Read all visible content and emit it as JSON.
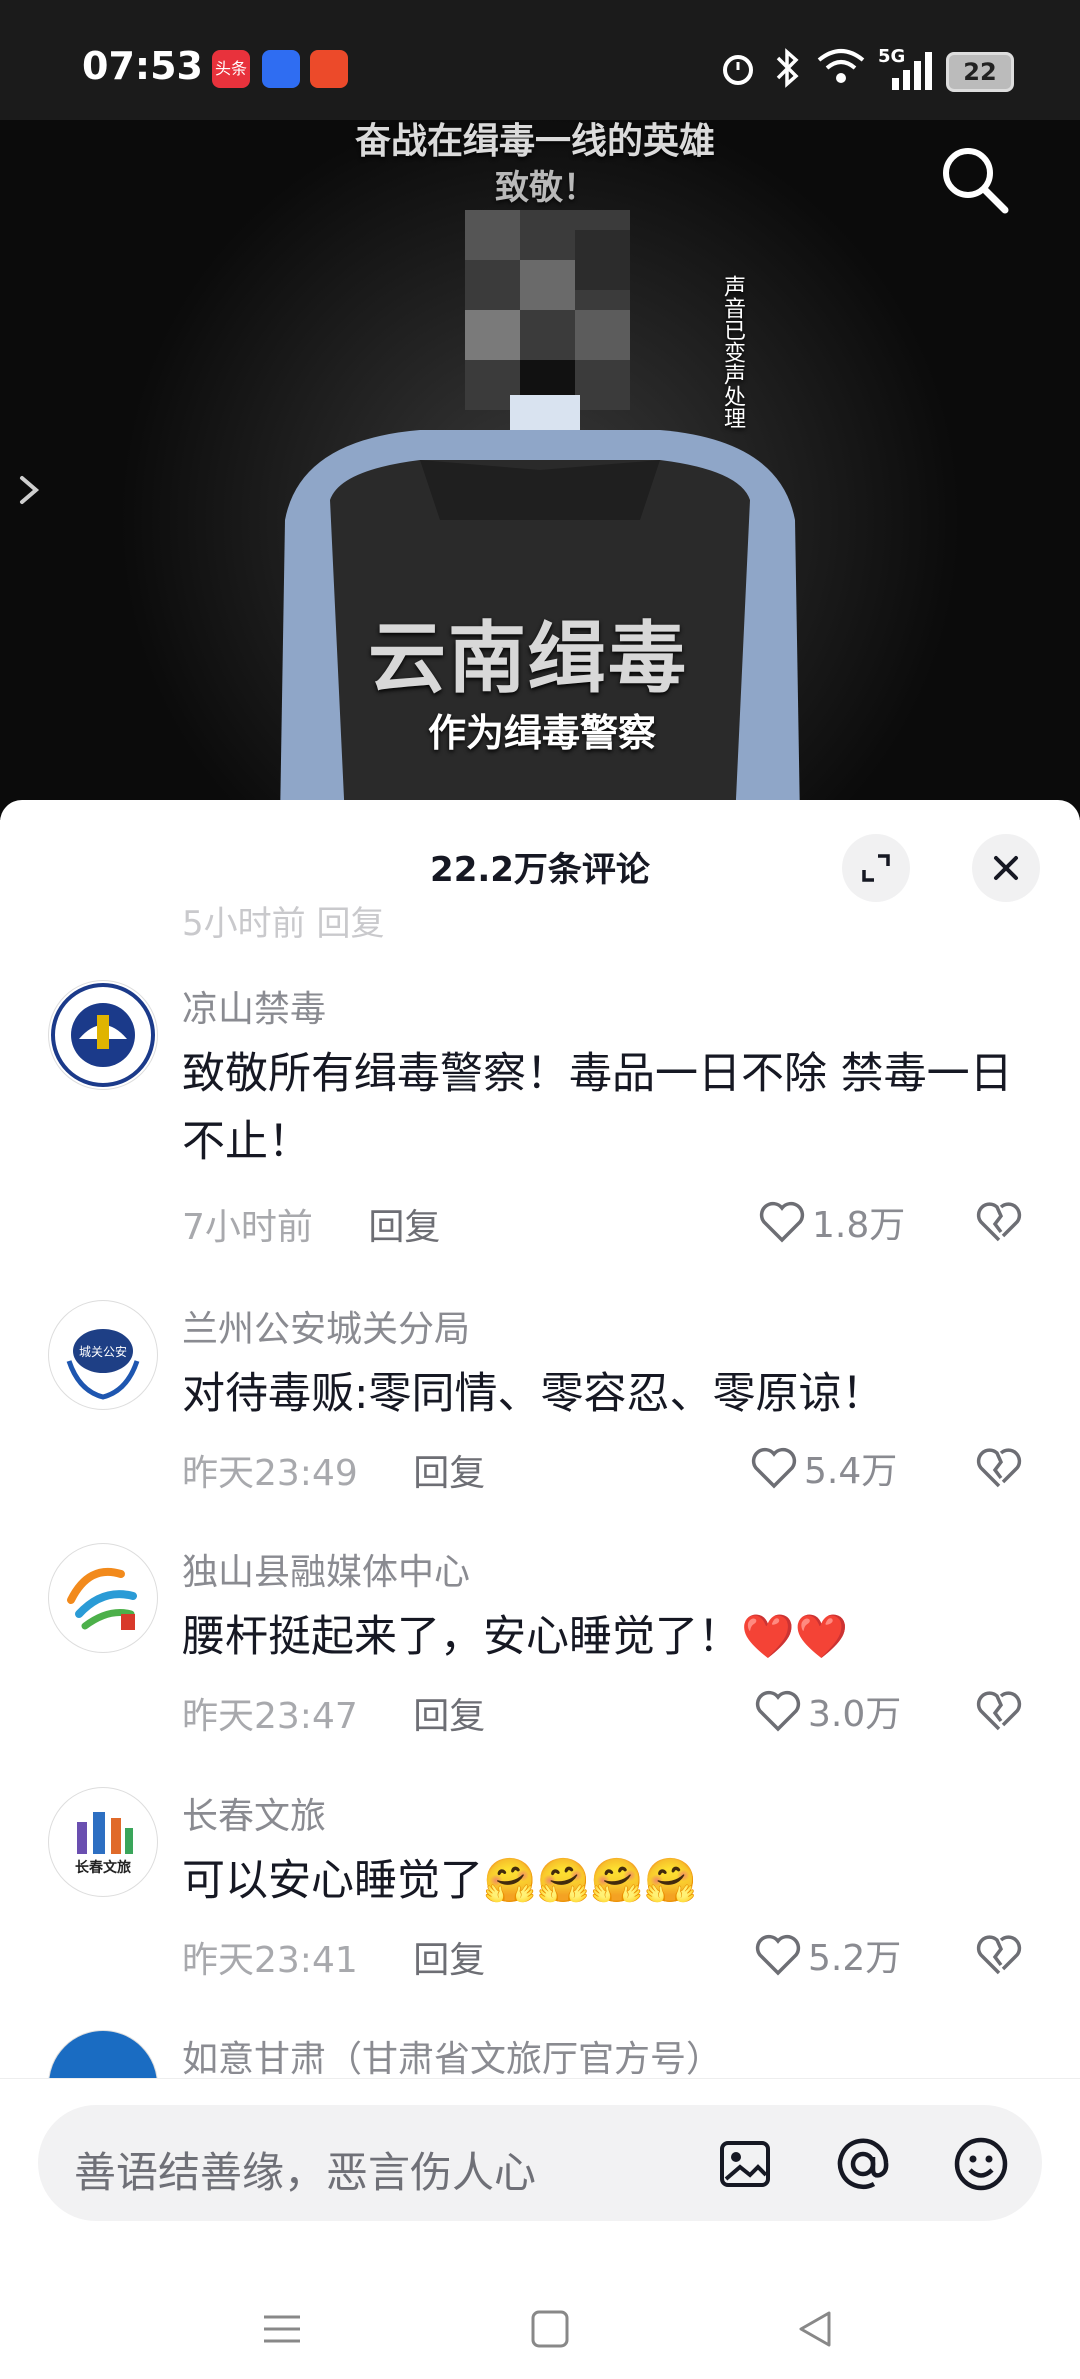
{
  "status_bar": {
    "time": "07:53",
    "app_icons": [
      "toutiao-icon",
      "news-app-icon",
      "app-icon"
    ],
    "app_label_1": "头条",
    "network": "5G",
    "battery": "22"
  },
  "video": {
    "caption_top": "奋战在缉毒一线的英雄",
    "caption_top2": "致敬！",
    "vertical_note": "声音已变声处理",
    "vest_text": "云南缉毒",
    "subtitle": "作为缉毒警察"
  },
  "comments_panel": {
    "title": "22.2万条评论",
    "partial_top": "5小时前   回复",
    "comments": [
      {
        "name": "凉山禁毒",
        "text": "致敬所有缉毒警察！毒品一日不除 禁毒一日不止！",
        "time": "7小时前",
        "reply": "回复",
        "likes": "1.8万"
      },
      {
        "name": "兰州公安城关分局",
        "text": "对待毒贩:零同情、零容忍、零原谅！",
        "time": "昨天23:49",
        "reply": "回复",
        "likes": "5.4万"
      },
      {
        "name": "独山县融媒体中心",
        "text": "腰杆挺起来了，安心睡觉了！❤️❤️",
        "time": "昨天23:47",
        "reply": "回复",
        "likes": "3.0万"
      },
      {
        "name": "长春文旅",
        "text": "可以安心睡觉了🤗🤗🤗🤗",
        "time": "昨天23:41",
        "reply": "回复",
        "likes": "5.2万"
      },
      {
        "name": "如意甘肃（甘肃省文旅厅官方号）"
      }
    ],
    "avatar_texts": {
      "liangshan": "凉山禁毒",
      "chenguan": "城关公安",
      "changchun": "长春文旅"
    }
  },
  "input_bar": {
    "placeholder": "善语结善缘，恶言伤人心",
    "icons": [
      "image-icon",
      "at-icon",
      "emoji-icon"
    ]
  },
  "colors": {
    "accent_red": "#fe2c55",
    "text": "#161823",
    "muted": "#8a8b91"
  }
}
